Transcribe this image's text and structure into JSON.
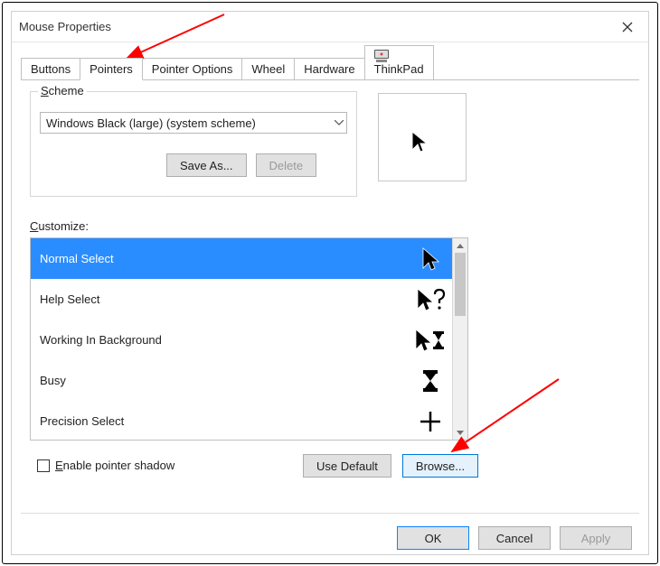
{
  "window": {
    "title": "Mouse Properties"
  },
  "tabs": [
    {
      "label": "Buttons"
    },
    {
      "label": "Pointers"
    },
    {
      "label": "Pointer Options"
    },
    {
      "label": "Wheel"
    },
    {
      "label": "Hardware"
    },
    {
      "label": "ThinkPad"
    }
  ],
  "scheme": {
    "legend": "Scheme",
    "selected": "Windows Black (large) (system scheme)",
    "save_label": "Save As...",
    "delete_label": "Delete"
  },
  "customize_label": "Customize:",
  "cursor_list": [
    {
      "name": "Normal Select"
    },
    {
      "name": "Help Select"
    },
    {
      "name": "Working In Background"
    },
    {
      "name": "Busy"
    },
    {
      "name": "Precision Select"
    }
  ],
  "enable_shadow_label": "Enable pointer shadow",
  "use_default_label": "Use Default",
  "browse_label": "Browse...",
  "dialog_buttons": {
    "ok": "OK",
    "cancel": "Cancel",
    "apply": "Apply"
  }
}
